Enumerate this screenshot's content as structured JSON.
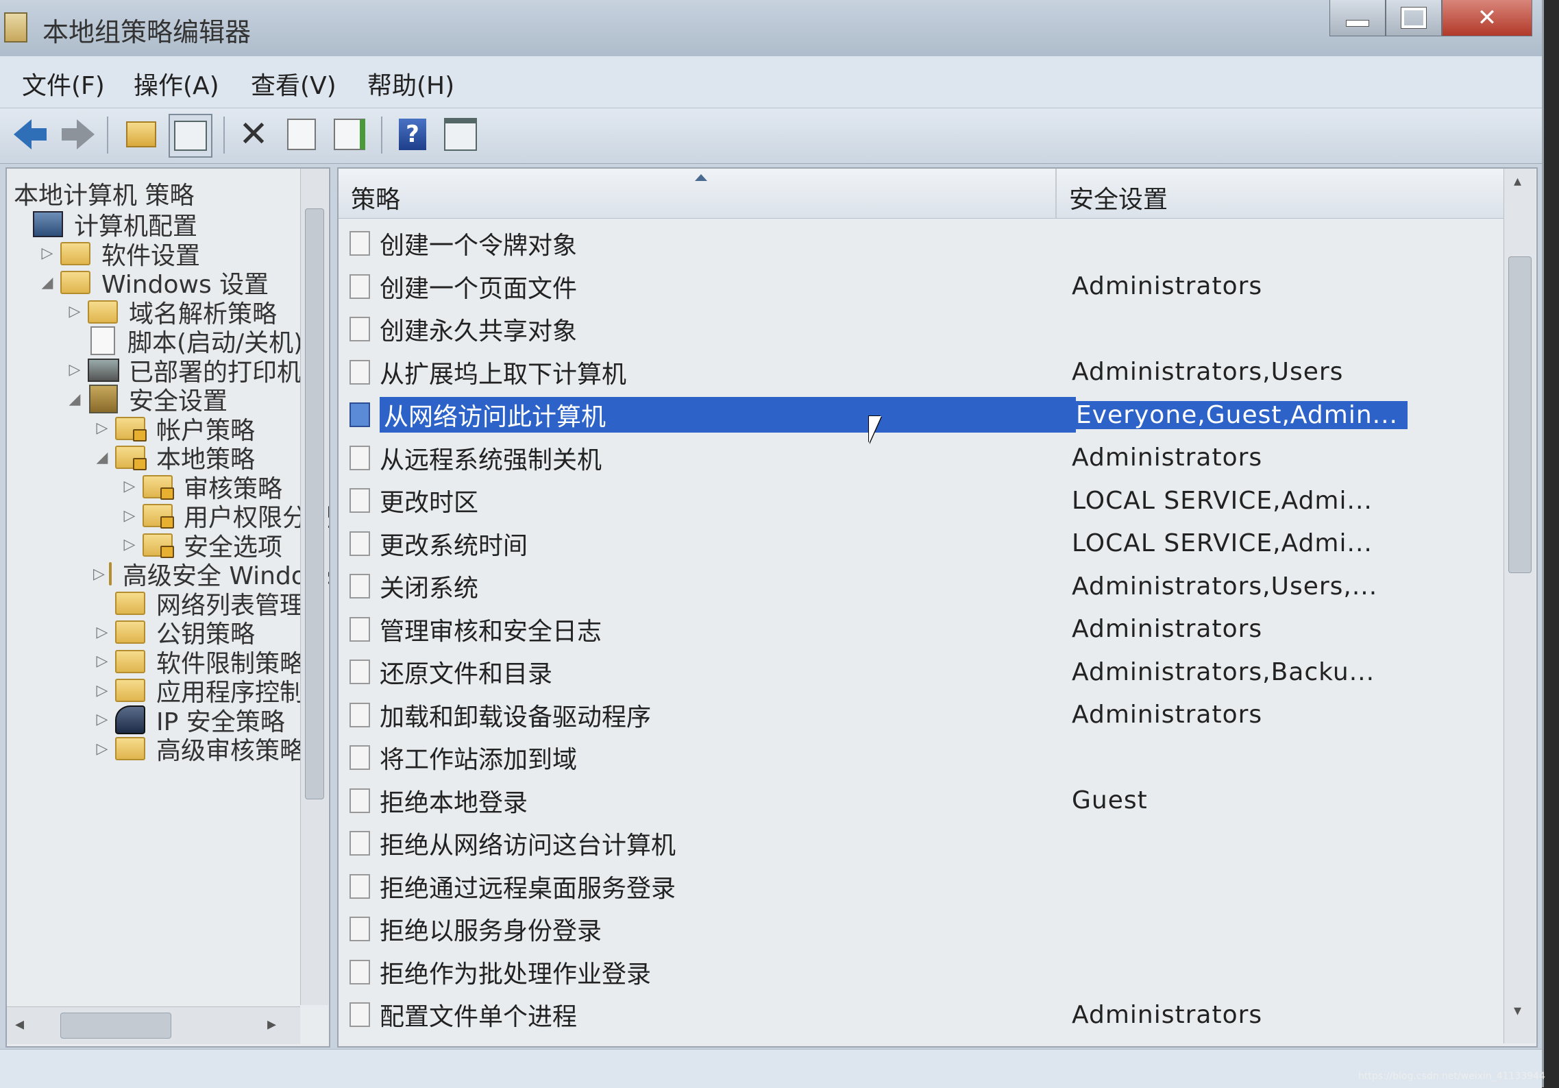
{
  "window": {
    "title": "本地组策略编辑器"
  },
  "menubar": {
    "items": [
      "文件(F)",
      "操作(A)",
      "查看(V)",
      "帮助(H)"
    ]
  },
  "toolbar": {
    "buttons": [
      "back-icon",
      "forward-icon",
      "up-folder-icon",
      "show-hide-tree-icon",
      "delete-icon",
      "properties-icon",
      "export-list-icon",
      "help-icon",
      "extended-view-icon"
    ]
  },
  "tree": {
    "header": "本地计算机 策略",
    "items": [
      {
        "label": "计算机配置",
        "expander": "",
        "icon": "computer-config-icon"
      },
      {
        "label": "软件设置",
        "expander": "▷",
        "icon": "folder-icon"
      },
      {
        "label": "Windows 设置",
        "expander": "◢",
        "icon": "folder-icon"
      },
      {
        "label": "域名解析策略",
        "expander": "▷",
        "icon": "folder-icon"
      },
      {
        "label": "脚本(启动/关机)",
        "expander": "",
        "icon": "script-icon"
      },
      {
        "label": "已部署的打印机",
        "expander": "▷",
        "icon": "printer-icon"
      },
      {
        "label": "安全设置",
        "expander": "◢",
        "icon": "security-settings-icon"
      },
      {
        "label": "帐户策略",
        "expander": "▷",
        "icon": "locked-folder-icon"
      },
      {
        "label": "本地策略",
        "expander": "◢",
        "icon": "locked-folder-icon"
      },
      {
        "label": "审核策略",
        "expander": "▷",
        "icon": "locked-folder-icon"
      },
      {
        "label": "用户权限分配",
        "expander": "▷",
        "icon": "locked-folder-icon"
      },
      {
        "label": "安全选项",
        "expander": "▷",
        "icon": "locked-folder-icon"
      },
      {
        "label": "高级安全 Windows 防火墙",
        "expander": "▷",
        "icon": "folder-icon"
      },
      {
        "label": "网络列表管理器策略",
        "expander": "",
        "icon": "folder-icon"
      },
      {
        "label": "公钥策略",
        "expander": "▷",
        "icon": "folder-icon"
      },
      {
        "label": "软件限制策略",
        "expander": "▷",
        "icon": "folder-icon"
      },
      {
        "label": "应用程序控制策略",
        "expander": "▷",
        "icon": "folder-icon"
      },
      {
        "label": "IP 安全策略",
        "expander": "▷",
        "icon": "ip-security-icon"
      },
      {
        "label": "高级审核策略配置",
        "expander": "▷",
        "icon": "folder-icon"
      }
    ]
  },
  "list": {
    "columns": [
      "策略",
      "安全设置"
    ],
    "rows": [
      {
        "policy": "创建一个令牌对象",
        "setting": ""
      },
      {
        "policy": "创建一个页面文件",
        "setting": "Administrators"
      },
      {
        "policy": "创建永久共享对象",
        "setting": ""
      },
      {
        "policy": "从扩展坞上取下计算机",
        "setting": "Administrators,Users"
      },
      {
        "policy": "从网络访问此计算机",
        "setting": "Everyone,Guest,Admin..."
      },
      {
        "policy": "从远程系统强制关机",
        "setting": "Administrators"
      },
      {
        "policy": "更改时区",
        "setting": "LOCAL SERVICE,Admi..."
      },
      {
        "policy": "更改系统时间",
        "setting": "LOCAL SERVICE,Admi..."
      },
      {
        "policy": "关闭系统",
        "setting": "Administrators,Users,..."
      },
      {
        "policy": "管理审核和安全日志",
        "setting": "Administrators"
      },
      {
        "policy": "还原文件和目录",
        "setting": "Administrators,Backu..."
      },
      {
        "policy": "加载和卸载设备驱动程序",
        "setting": "Administrators"
      },
      {
        "policy": "将工作站添加到域",
        "setting": ""
      },
      {
        "policy": "拒绝本地登录",
        "setting": "Guest"
      },
      {
        "policy": "拒绝从网络访问这台计算机",
        "setting": ""
      },
      {
        "policy": "拒绝通过远程桌面服务登录",
        "setting": ""
      },
      {
        "policy": "拒绝以服务身份登录",
        "setting": ""
      },
      {
        "policy": "拒绝作为批处理作业登录",
        "setting": ""
      },
      {
        "policy": "配置文件单个进程",
        "setting": "Administrators"
      }
    ],
    "selected_index": 4
  },
  "watermark": "https://blog.csdn.net/weixin_41133944"
}
